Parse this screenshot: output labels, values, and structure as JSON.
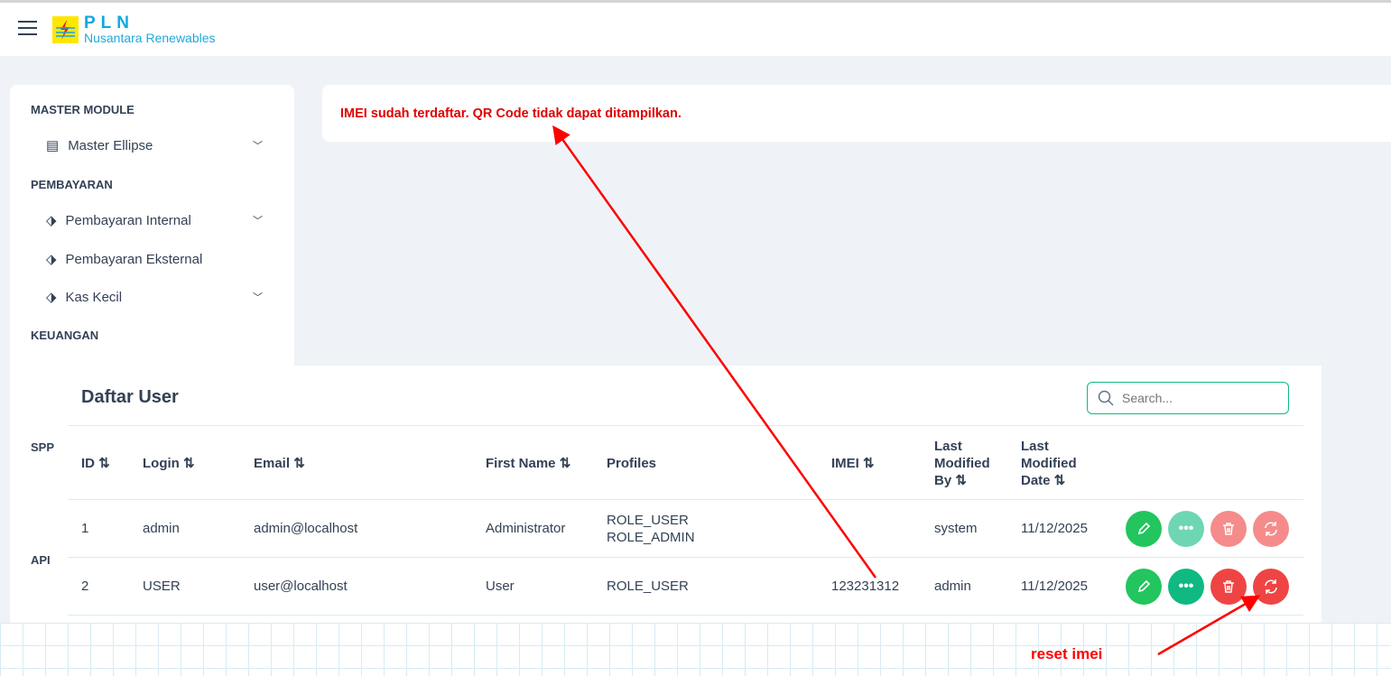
{
  "header": {
    "logo_title": "PLN",
    "logo_subtitle": "Nusantara Renewables"
  },
  "sidebar": {
    "sections": [
      {
        "label": "MASTER MODULE"
      },
      {
        "label": "PEMBAYARAN"
      },
      {
        "label": "KEUANGAN"
      },
      {
        "label": "SPP"
      },
      {
        "label": "API"
      }
    ],
    "items": [
      {
        "label": "Master Ellipse"
      },
      {
        "label": "Pembayaran Internal"
      },
      {
        "label": "Pembayaran Eksternal"
      },
      {
        "label": "Kas Kecil"
      }
    ]
  },
  "alert": {
    "message": "IMEI sudah terdaftar. QR Code tidak dapat ditampilkan.",
    "color": "#e00000"
  },
  "table": {
    "title": "Daftar User",
    "search_placeholder": "Search...",
    "columns": [
      "ID",
      "Login",
      "Email",
      "First Name",
      "Profiles",
      "IMEI",
      "Last Modified By",
      "Last Modified Date"
    ],
    "rows": [
      {
        "id": "1",
        "login": "admin",
        "email": "admin@localhost",
        "first_name": "Administrator",
        "profiles": [
          "ROLE_USER",
          "ROLE_ADMIN"
        ],
        "imei": "",
        "modified_by": "system",
        "modified_date": "11/12/2025"
      },
      {
        "id": "2",
        "login": "USER",
        "email": "user@localhost",
        "first_name": "User",
        "profiles": [
          "ROLE_USER"
        ],
        "imei": "123231312",
        "modified_by": "admin",
        "modified_date": "11/12/2025"
      }
    ]
  },
  "annotation": {
    "label": "reset imei"
  }
}
